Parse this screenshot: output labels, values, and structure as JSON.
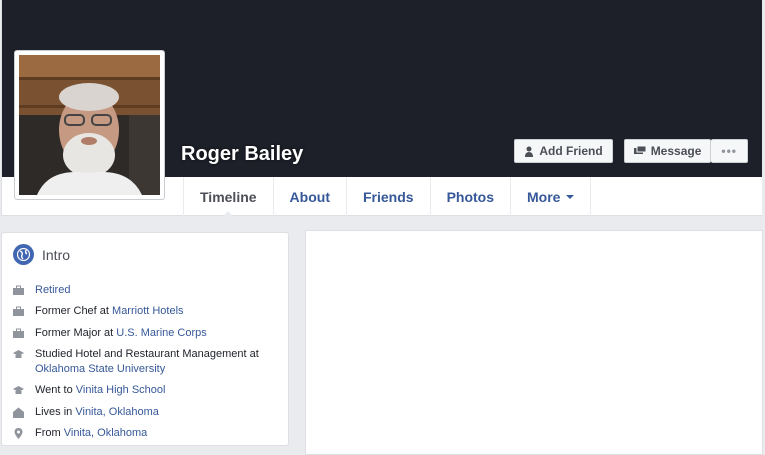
{
  "profile": {
    "name": "Roger Bailey",
    "add_friend_label": "Add Friend",
    "message_label": "Message",
    "more_dots": "•••"
  },
  "tabs": [
    {
      "label": "Timeline"
    },
    {
      "label": "About"
    },
    {
      "label": "Friends"
    },
    {
      "label": "Photos"
    },
    {
      "label": "More"
    }
  ],
  "intro": {
    "title": "Intro",
    "items": [
      {
        "icon": "briefcase-icon",
        "link": "Retired"
      },
      {
        "icon": "briefcase-icon",
        "prefix": "Former Chef at ",
        "link": "Marriott Hotels"
      },
      {
        "icon": "briefcase-icon",
        "prefix": "Former Major at ",
        "link": "U.S. Marine Corps"
      },
      {
        "icon": "graduation-cap-icon",
        "prefix": "Studied Hotel and Restaurant Management at ",
        "link": "Oklahoma State University"
      },
      {
        "icon": "graduation-cap-icon",
        "prefix": "Went to ",
        "link": "Vinita High School"
      },
      {
        "icon": "house-icon",
        "prefix": "Lives in ",
        "link": "Vinita, Oklahoma"
      },
      {
        "icon": "location-pin-icon",
        "prefix": "From ",
        "link": "Vinita, Oklahoma"
      }
    ]
  },
  "colors": {
    "cover": "#1d2029",
    "link": "#365899",
    "page_bg": "#e9ebee",
    "globe": "#4267b2"
  }
}
